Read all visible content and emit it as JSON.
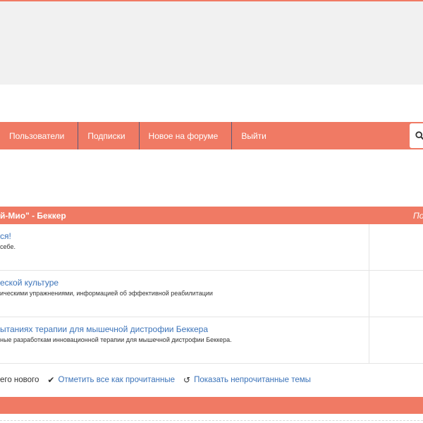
{
  "colors": {
    "accent": "#f07a64",
    "link": "#3b73b9",
    "banner": "#f1f1f1"
  },
  "nav": {
    "items": [
      {
        "label": "Пользователи"
      },
      {
        "label": "Подписки"
      },
      {
        "label": "Новое на форуме"
      },
      {
        "label": "Выйти"
      }
    ],
    "search_icon": "search-icon"
  },
  "category": {
    "title": "й-Мио\" - Беккер",
    "right_label": "По"
  },
  "forums": [
    {
      "title": "ся!",
      "description": "себе."
    },
    {
      "title": "еской культуре",
      "description": "ическими упражнениями, информацией об эффективной реабилитации"
    },
    {
      "title": "ытаниях терапии для мышечной дистрофии Беккера",
      "description": "ные разработкам инновационной терапии для мышечной дистрофии Беккера."
    }
  ],
  "actions": {
    "no_new_text": "его нового",
    "mark_read": "Отметить все как прочитанные",
    "mark_read_icon": "checkmark-icon",
    "show_unread": "Показать непрочитанные темы",
    "show_unread_icon": "history-icon"
  }
}
